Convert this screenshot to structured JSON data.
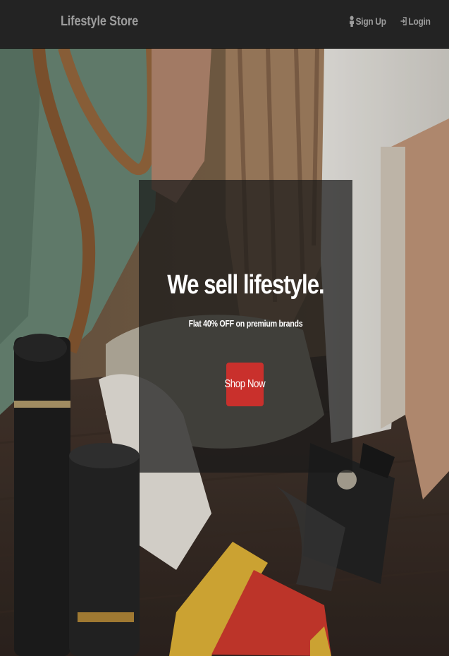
{
  "navbar": {
    "brand": "Lifestyle Store",
    "links": [
      {
        "label": "Sign Up",
        "icon": "user-icon"
      },
      {
        "label": "Login",
        "icon": "login-icon"
      }
    ]
  },
  "hero": {
    "headline": "We sell lifestyle.",
    "subheadline": "Flat 40% OFF on premium brands",
    "cta_label": "Shop Now",
    "background": "photo of lifestyle products on a wooden table",
    "colors": {
      "navbar": "#232323",
      "nav_text": "#9d9d9d",
      "cta": "#c9302c",
      "overlay": "rgba(25,25,25,0.72)"
    }
  }
}
